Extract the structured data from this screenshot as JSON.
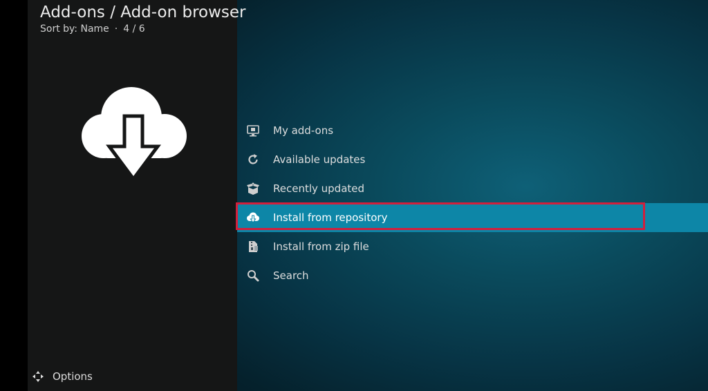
{
  "header": {
    "title": "Add-ons / Add-on browser",
    "sort_label": "Sort by: Name",
    "separator": "·",
    "position": "4 / 6"
  },
  "menu": {
    "items": [
      {
        "label": "My add-ons",
        "icon": "monitor-box-icon"
      },
      {
        "label": "Available updates",
        "icon": "refresh-icon"
      },
      {
        "label": "Recently updated",
        "icon": "open-box-icon"
      },
      {
        "label": "Install from repository",
        "icon": "cloud-download-icon",
        "selected": true
      },
      {
        "label": "Install from zip file",
        "icon": "zip-file-icon"
      },
      {
        "label": "Search",
        "icon": "search-icon"
      }
    ]
  },
  "footer": {
    "options_label": "Options",
    "options_icon": "options-arrows-icon"
  },
  "colors": {
    "selected_row": "#0d86a7",
    "highlight_border": "#d21f3c",
    "left_panel": "#151616"
  }
}
